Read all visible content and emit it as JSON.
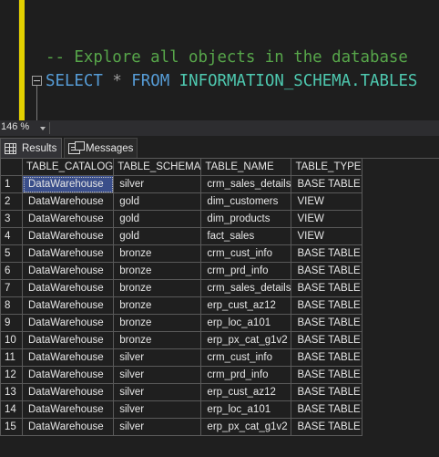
{
  "editor": {
    "comment_line": "-- Explore all objects in the database",
    "sql_keyword_select": "SELECT",
    "sql_star": "*",
    "sql_keyword_from": "FROM",
    "sql_table": "INFORMATION_SCHEMA.TABLES"
  },
  "zoom": {
    "value": "146 %"
  },
  "tabs": [
    {
      "label": "Results",
      "icon": "grid-icon",
      "active": true
    },
    {
      "label": "Messages",
      "icon": "messages-icon",
      "active": false
    }
  ],
  "results": {
    "columns": [
      "TABLE_CATALOG",
      "TABLE_SCHEMA",
      "TABLE_NAME",
      "TABLE_TYPE"
    ],
    "rows": [
      [
        "1",
        "DataWarehouse",
        "silver",
        "crm_sales_details",
        "BASE TABLE"
      ],
      [
        "2",
        "DataWarehouse",
        "gold",
        "dim_customers",
        "VIEW"
      ],
      [
        "3",
        "DataWarehouse",
        "gold",
        "dim_products",
        "VIEW"
      ],
      [
        "4",
        "DataWarehouse",
        "gold",
        "fact_sales",
        "VIEW"
      ],
      [
        "5",
        "DataWarehouse",
        "bronze",
        "crm_cust_info",
        "BASE TABLE"
      ],
      [
        "6",
        "DataWarehouse",
        "bronze",
        "crm_prd_info",
        "BASE TABLE"
      ],
      [
        "7",
        "DataWarehouse",
        "bronze",
        "crm_sales_details",
        "BASE TABLE"
      ],
      [
        "8",
        "DataWarehouse",
        "bronze",
        "erp_cust_az12",
        "BASE TABLE"
      ],
      [
        "9",
        "DataWarehouse",
        "bronze",
        "erp_loc_a101",
        "BASE TABLE"
      ],
      [
        "10",
        "DataWarehouse",
        "bronze",
        "erp_px_cat_g1v2",
        "BASE TABLE"
      ],
      [
        "11",
        "DataWarehouse",
        "silver",
        "crm_cust_info",
        "BASE TABLE"
      ],
      [
        "12",
        "DataWarehouse",
        "silver",
        "crm_prd_info",
        "BASE TABLE"
      ],
      [
        "13",
        "DataWarehouse",
        "silver",
        "erp_cust_az12",
        "BASE TABLE"
      ],
      [
        "14",
        "DataWarehouse",
        "silver",
        "erp_loc_a101",
        "BASE TABLE"
      ],
      [
        "15",
        "DataWarehouse",
        "silver",
        "erp_px_cat_g1v2",
        "BASE TABLE"
      ]
    ]
  },
  "colors": {
    "change_bar": "#e3d000",
    "comment": "#57a64a",
    "keyword": "#569cd6",
    "identifier": "#4ec9b0",
    "selected_cell": "#3a4e8a"
  }
}
